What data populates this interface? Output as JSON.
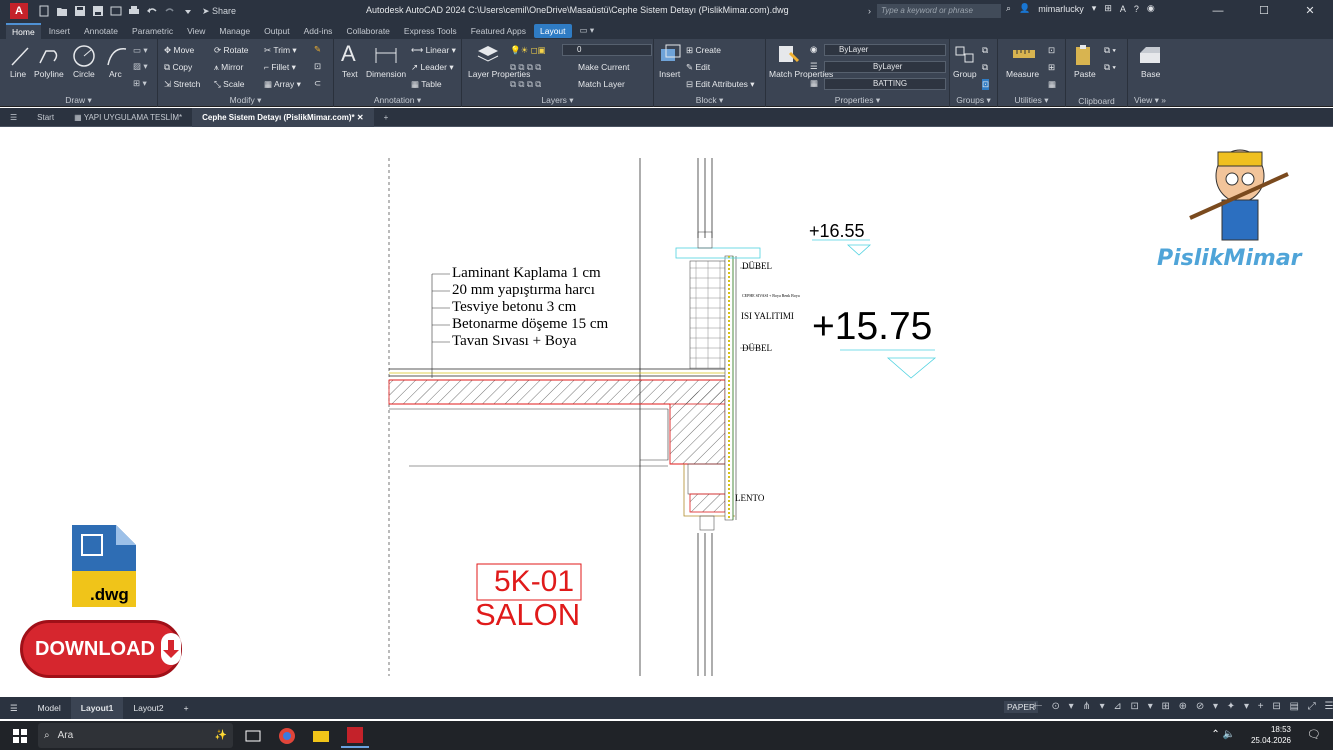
{
  "titlebar": {
    "app_logo": "A",
    "share": "Share",
    "title": "Autodesk AutoCAD 2024   C:\\Users\\cemil\\OneDrive\\Masaüstü\\Cephe Sistem Detayı (PislikMimar.com).dwg",
    "search_placeholder": "Type a keyword or phrase",
    "user": "mimarlucky"
  },
  "ribbon_tabs": [
    "Home",
    "Insert",
    "Annotate",
    "Parametric",
    "View",
    "Manage",
    "Output",
    "Add-ins",
    "Collaborate",
    "Express Tools",
    "Featured Apps",
    "Layout"
  ],
  "panels": {
    "draw": {
      "title": "Draw",
      "line": "Line",
      "polyline": "Polyline",
      "circle": "Circle",
      "arc": "Arc"
    },
    "modify": {
      "title": "Modify",
      "move": "Move",
      "rotate": "Rotate",
      "trim": "Trim",
      "copy": "Copy",
      "mirror": "Mirror",
      "fillet": "Fillet",
      "stretch": "Stretch",
      "scale": "Scale",
      "array": "Array"
    },
    "annotation": {
      "title": "Annotation",
      "text": "Text",
      "dimension": "Dimension",
      "linear": "Linear",
      "leader": "Leader",
      "table": "Table"
    },
    "layers": {
      "title": "Layers",
      "layer_properties": "Layer Properties",
      "current_layer": "0",
      "make_current": "Make Current",
      "match_layer": "Match Layer"
    },
    "block": {
      "title": "Block",
      "insert": "Insert",
      "create": "Create",
      "edit": "Edit",
      "edit_attributes": "Edit Attributes"
    },
    "properties": {
      "title": "Properties",
      "match_properties": "Match Properties",
      "color": "ByLayer",
      "lineweight": "ByLayer",
      "linetype": "BATTING"
    },
    "groups": {
      "title": "Groups",
      "group": "Group"
    },
    "utilities": {
      "title": "Utilities",
      "measure": "Measure"
    },
    "clipboard": {
      "title": "Clipboard",
      "paste": "Paste"
    },
    "view": {
      "title": "View",
      "base": "Base"
    }
  },
  "doc_tabs": {
    "start": "Start",
    "tab1": "YAPI UYGULAMA TESLİM*",
    "tab2": "Cephe Sistem Detayı (PislikMimar.com)*"
  },
  "drawing": {
    "labels": [
      "Laminant Kaplama 1 cm",
      "20 mm yapıştırma harcı",
      "Tesviye betonu 3 cm",
      "Betonarme döşeme 15 cm",
      "Tavan Sıvası + Boya"
    ],
    "dubel1": "DÜBEL",
    "dubel2": "DÜBEL",
    "insulation": "ISI YALITIMI",
    "small_note": "CEPHE SIVASI + Boya Renk Boya",
    "lento": "LENTO",
    "elev_small": "+16.55",
    "elev_big": "+15.75",
    "room_code": "5K-01",
    "room_name": "SALON",
    "watermark": "PislikMimar",
    "dwg_label": ".dwg",
    "download": "DOWNLOAD"
  },
  "status": {
    "model": "Model",
    "layout1": "Layout1",
    "layout2": "Layout2",
    "paper": "PAPER"
  },
  "taskbar": {
    "search": "Ara",
    "time": "18:53",
    "date": "25.04.2026"
  },
  "colors": {
    "accent": "#2f7cc4",
    "hatch_red": "#e01a1a",
    "dim_cyan": "#4fd2e0",
    "insulation_yellow": "#d8c21a"
  }
}
